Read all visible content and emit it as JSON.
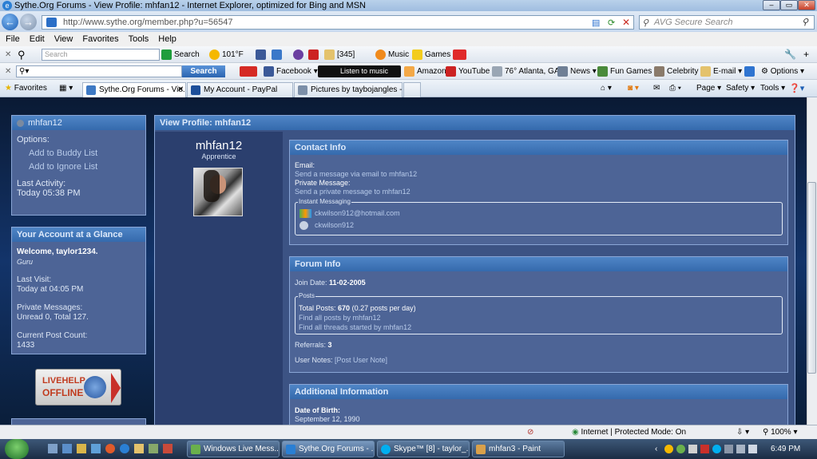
{
  "window": {
    "title": "Sythe.Org Forums - View Profile: mhfan12 - Internet Explorer, optimized for Bing and MSN"
  },
  "address": {
    "url": "http://www.sythe.org/member.php?u=56547",
    "search_placeholder": "AVG Secure Search"
  },
  "menu": [
    "File",
    "Edit",
    "View",
    "Favorites",
    "Tools",
    "Help"
  ],
  "toolbar1": {
    "search_placeholder": "Search",
    "search_label": "Search",
    "temp": "101°F",
    "mail_count": "[345]",
    "music": "Music",
    "games": "Games"
  },
  "toolbar2": {
    "search_button": "Search",
    "facebook": "Facebook",
    "listen": "Listen to music",
    "amazon": "Amazon",
    "youtube": "YouTube",
    "weather": "76° Atlanta, GA",
    "news": "News",
    "fun_games": "Fun Games",
    "celebrity": "Celebrity",
    "email": "E-mail",
    "options": "Options"
  },
  "tabs": {
    "favorites": "Favorites",
    "tab1": "Sythe.Org Forums - Vie...",
    "tab2": "My Account - PayPal",
    "tab3": "Pictures by taybojangles - ...",
    "page": "Page",
    "safety": "Safety",
    "tools": "Tools"
  },
  "sidebar": {
    "username": "mhfan12",
    "options_label": "Options:",
    "buddy": "Add to Buddy List",
    "ignore": "Add to Ignore List",
    "last_activity_label": "Last Activity:",
    "last_activity": "Today 05:38 PM",
    "account_head": "Your Account at a Glance",
    "welcome": "Welcome, taylor1234.",
    "rank": "Guru",
    "last_visit_label": "Last Visit:",
    "last_visit": "Today at 04:05 PM",
    "pm_label": "Private Messages:",
    "pm_value": "Unread 0, Total 127.",
    "post_count_label": "Current Post Count:",
    "post_count": "1433",
    "livehelp_1": "LIVEHELP",
    "livehelp_2": "OFFLINE"
  },
  "profile": {
    "head": "View Profile: mhfan12",
    "name": "mhfan12",
    "title": "Apprentice",
    "contact": {
      "head": "Contact Info",
      "email_label": "Email:",
      "email_link": "Send a message via email to mhfan12",
      "pm_label": "Private Message:",
      "pm_link": "Send a private message to mhfan12",
      "im_legend": "Instant Messaging",
      "msn": "ckwilson912@hotmail.com",
      "skype": "ckwilson912"
    },
    "forum": {
      "head": "Forum Info",
      "join_label": "Join Date:",
      "join_date": "11-02-2005",
      "posts_legend": "Posts",
      "total_label": "Total Posts:",
      "total": "670",
      "per_day": "(0.27 posts per day)",
      "find_posts": "Find all posts by mhfan12",
      "find_threads": "Find all threads started by mhfan12",
      "referrals_label": "Referrals:",
      "referrals": "3",
      "notes_label": "User Notes:",
      "notes_link": "[Post User Note]"
    },
    "additional": {
      "head": "Additional Information",
      "dob_label": "Date of Birth:",
      "dob": "September 12, 1990"
    }
  },
  "status": {
    "zone": "Internet | Protected Mode: On",
    "zoom": "100%"
  },
  "taskbar": {
    "t1": "Windows Live Mess...",
    "t2": "Sythe.Org Forums - ...",
    "t3": "Skype™ [8] - taylor_...",
    "t4": "mhfan3 - Paint",
    "clock": "6:49 PM"
  }
}
